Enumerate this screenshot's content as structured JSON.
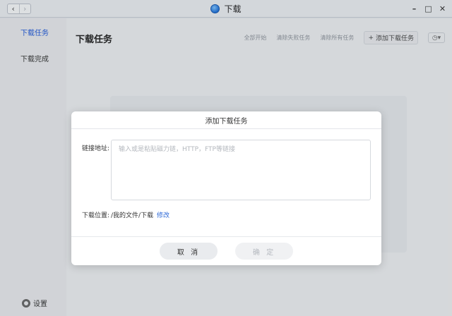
{
  "window": {
    "title": "下载",
    "nav_back": "‹",
    "nav_forward": "›",
    "controls": {
      "minimize": "–",
      "maximize": "□",
      "close": "✕"
    }
  },
  "sidebar": {
    "items": [
      {
        "label": "下载任务",
        "active": true
      },
      {
        "label": "下载完成",
        "active": false
      }
    ],
    "settings_label": "设置"
  },
  "main": {
    "title": "下载任务",
    "toolbar": {
      "start_all": "全部开始",
      "clear_failed": "清除失败任务",
      "clear_all": "清除所有任务",
      "add_task": "添加下载任务",
      "add_icon_glyph": "+",
      "sort_glyph": "◷▾"
    }
  },
  "dialog": {
    "title": "添加下载任务",
    "link_label": "链接地址:",
    "link_placeholder": "输入或是粘贴磁力链，HTTP，FTP等链接",
    "link_value": "",
    "location_label": "下载位置:",
    "location_path": "/我的文件/下载",
    "modify_label": "修改",
    "cancel_label": "取 消",
    "ok_label": "确 定"
  },
  "colors": {
    "accent": "#1c55d6",
    "link": "#2f6ad8"
  }
}
